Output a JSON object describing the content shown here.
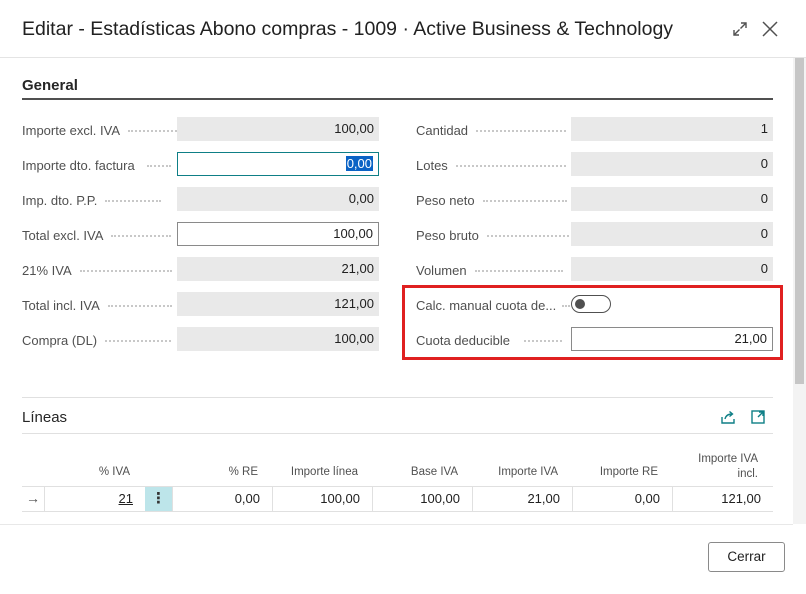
{
  "dialog": {
    "title": "Editar - Estadísticas Abono compras - 1009 · Active Business & Technology",
    "expand_icon": "expand-icon",
    "close_icon": "close-icon",
    "close_button": "Cerrar"
  },
  "general": {
    "heading": "General",
    "left_fields": [
      {
        "label": "Importe excl. IVA",
        "value": "100,00"
      },
      {
        "label": "Importe dto. factura",
        "value": "0,00"
      },
      {
        "label": "Imp. dto. P.P.",
        "value": "0,00"
      },
      {
        "label": "Total excl. IVA",
        "value": "100,00"
      },
      {
        "label": "21% IVA",
        "value": "21,00"
      },
      {
        "label": "Total incl. IVA",
        "value": "121,00"
      },
      {
        "label": "Compra (DL)",
        "value": "100,00"
      }
    ],
    "right_fields": [
      {
        "label": "Cantidad",
        "value": "1"
      },
      {
        "label": "Lotes",
        "value": "0"
      },
      {
        "label": "Peso neto",
        "value": "0"
      },
      {
        "label": "Peso bruto",
        "value": "0"
      },
      {
        "label": "Volumen",
        "value": "0"
      },
      {
        "label": "Calc. manual cuota de...",
        "value": "off"
      },
      {
        "label": "Cuota deducible",
        "value": "21,00"
      }
    ]
  },
  "lineas": {
    "heading": "Líneas",
    "share_icon": "share-icon",
    "open_icon": "open-in-new-icon",
    "columns": [
      "% IVA",
      "% RE",
      "Importe línea",
      "Base IVA",
      "Importe IVA",
      "Importe RE",
      "Importe IVA incl."
    ],
    "rows": [
      {
        "iva": "21",
        "re": "0,00",
        "importe_linea": "100,00",
        "base_iva": "100,00",
        "importe_iva": "21,00",
        "importe_re": "0,00",
        "importe_iva_incl": "121,00"
      }
    ]
  }
}
